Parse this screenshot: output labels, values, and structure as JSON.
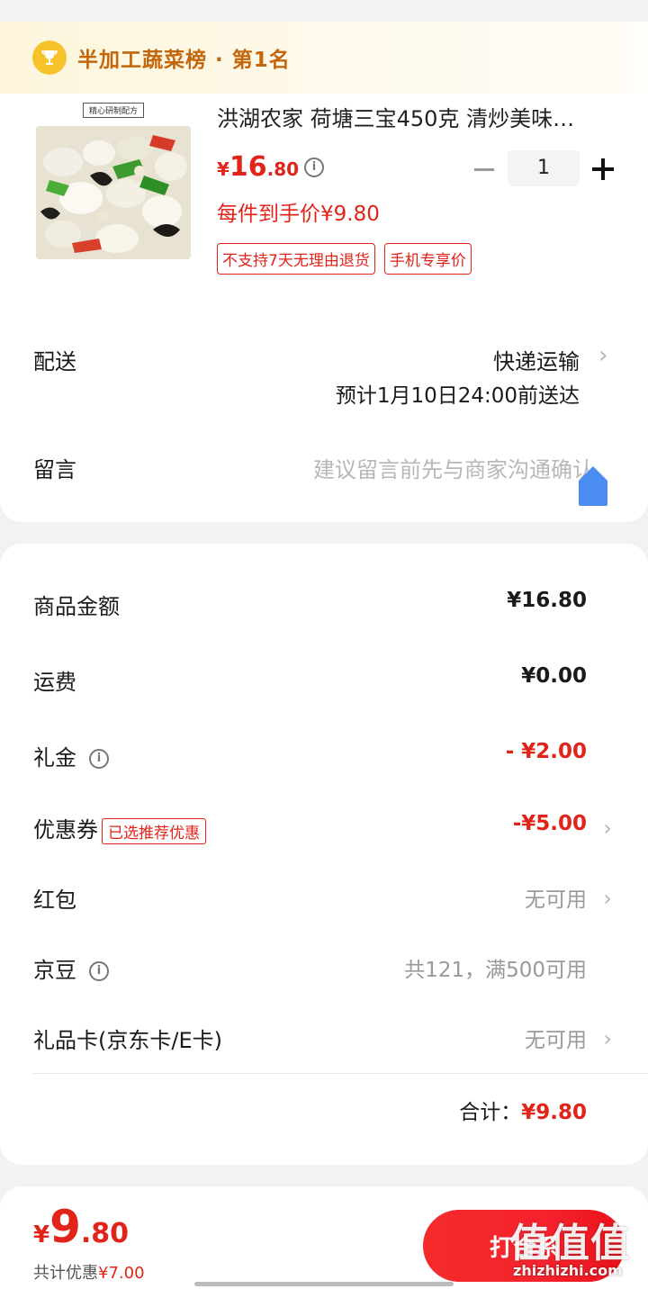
{
  "rank": {
    "icon": "trophy-icon",
    "text": "半加工蔬菜榜 · 第1名"
  },
  "product": {
    "image_label": "精心研制配方",
    "title": "洪湖农家  荷塘三宝450克  清炒美味…",
    "price_currency": "¥",
    "price_int": "16",
    "price_dec": ".80",
    "quantity": "1",
    "hand_price": "每件到手价¥9.80",
    "tags": [
      "不支持7天无理由退货",
      "手机专享价"
    ]
  },
  "delivery": {
    "label": "配送",
    "method": "快递运输",
    "eta": "预计1月10日24:00前送达"
  },
  "message": {
    "label": "留言",
    "placeholder": "建议留言前先与商家沟通确认"
  },
  "summary": {
    "goods_label": "商品金额",
    "goods_value": "¥16.80",
    "shipping_label": "运费",
    "shipping_value": "¥0.00",
    "gift_label": "礼金",
    "gift_value": "- ¥2.00",
    "coupon_label": "优惠券",
    "coupon_tag": "已选推荐优惠",
    "coupon_value": "-¥5.00",
    "redpack_label": "红包",
    "redpack_value": "无可用",
    "jingdou_label": "京豆",
    "jingdou_value": "共121，满500可用",
    "giftcard_label": "礼品卡(京东卡/E卡)",
    "giftcard_value": "无可用",
    "total_label": "合计：",
    "total_value": "¥9.80"
  },
  "bottom": {
    "currency": "¥",
    "price_int": "9",
    "price_dec": ".80",
    "save_label": "共计优惠",
    "save_value": "¥7.00",
    "pay_label": "打合系"
  },
  "watermark": {
    "logo": "值值值",
    "site": "zhizhizhi.com"
  },
  "colors": {
    "accent": "#e2231a",
    "rank_text": "#c4670c",
    "trophy": "#f7c32b",
    "blue": "#4a8cf0"
  }
}
